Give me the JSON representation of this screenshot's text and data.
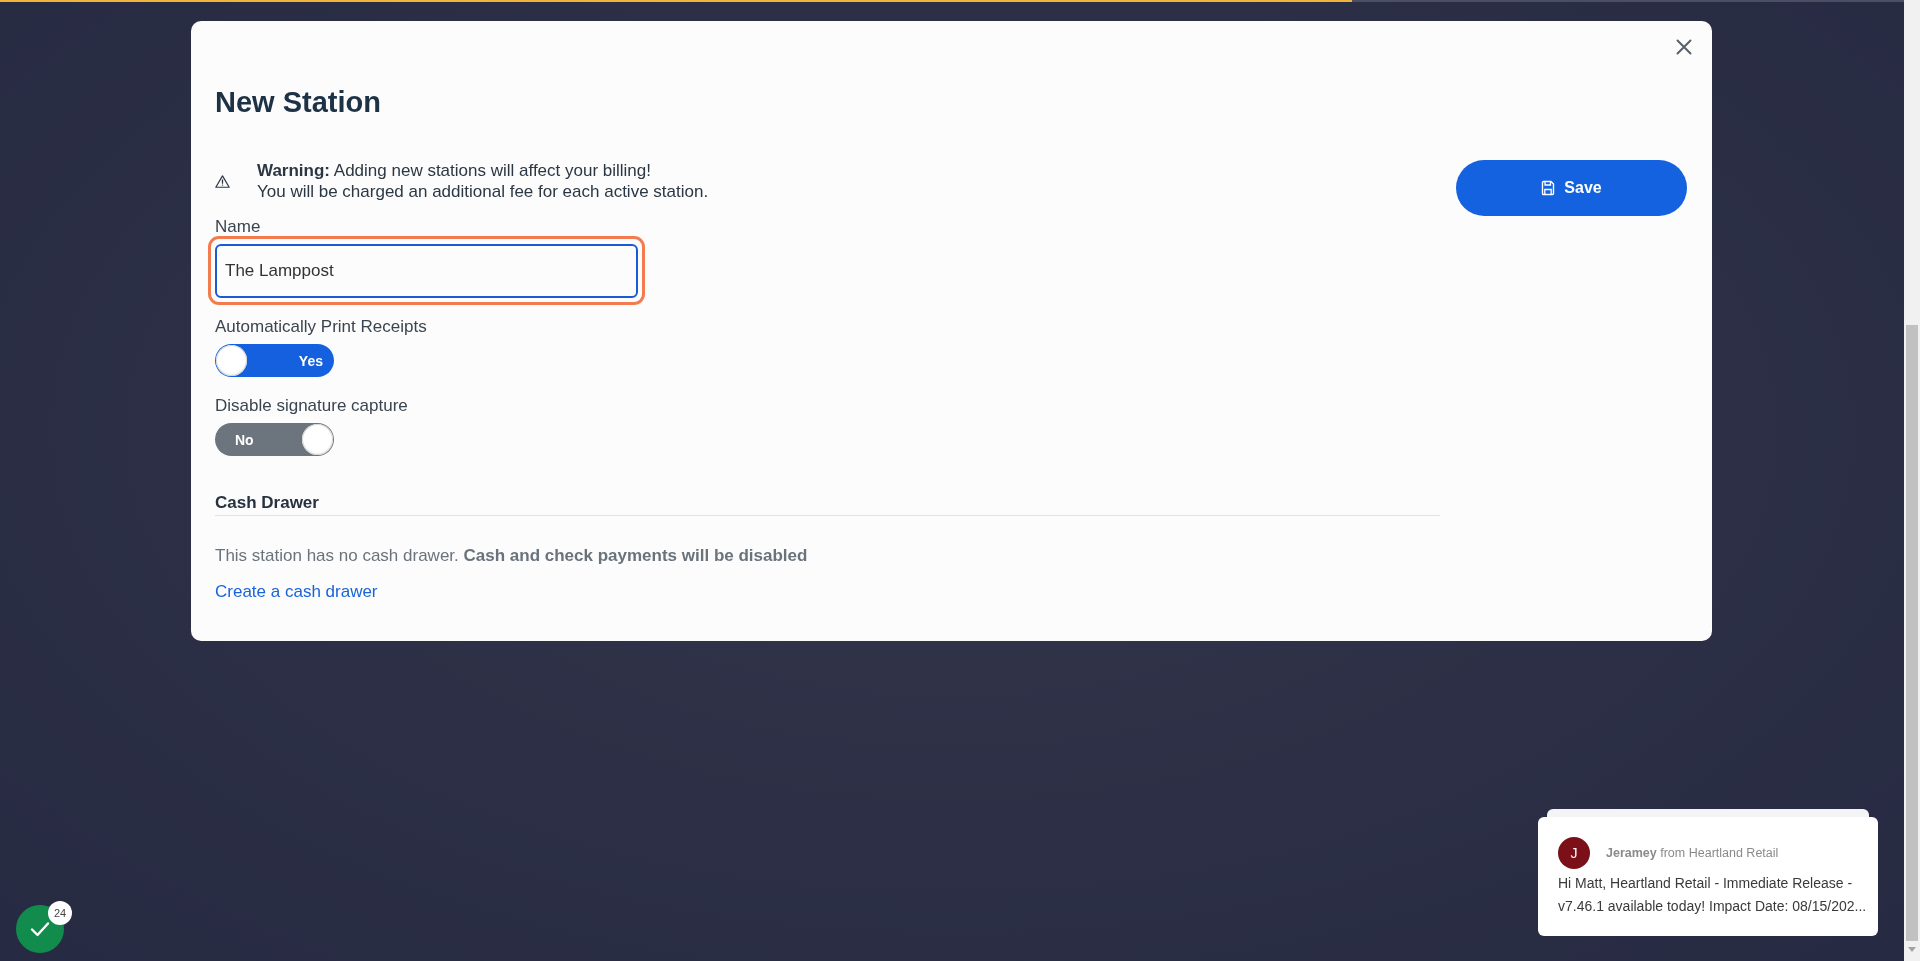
{
  "loading_bar": {
    "level": 0.71
  },
  "dialog": {
    "title": "New Station",
    "warning_lines": [
      "**Warning:** Adding new stations will affect your billing!",
      "You will be charged an additional fee for each active station."
    ],
    "fields": [
      {
        "kind": "text",
        "label": "Name",
        "value": "The Lamppost",
        "focused": true
      },
      {
        "kind": "toggle",
        "label": "Automatically Print Receipts",
        "on": true,
        "state_text": "Yes"
      },
      {
        "kind": "toggle",
        "label": "Disable signature capture",
        "on": false,
        "state_text": "No"
      }
    ],
    "cash_drawer": {
      "heading": "Cash Drawer",
      "message": "This station has no cash drawer. **Cash and check payments will be disabled**",
      "link": "Create a cash drawer"
    },
    "save_button": {
      "label": "Save"
    }
  },
  "chat_notification": {
    "avatar_letter": "J",
    "sender": "**Jeramey** from Heartland Retail",
    "message": "Hi Matt, Heartland Retail - Immediate Release - v7.46.1 available today! Impact Date: 08/15/202..."
  },
  "chat_launcher": {
    "badge_count": "24"
  }
}
